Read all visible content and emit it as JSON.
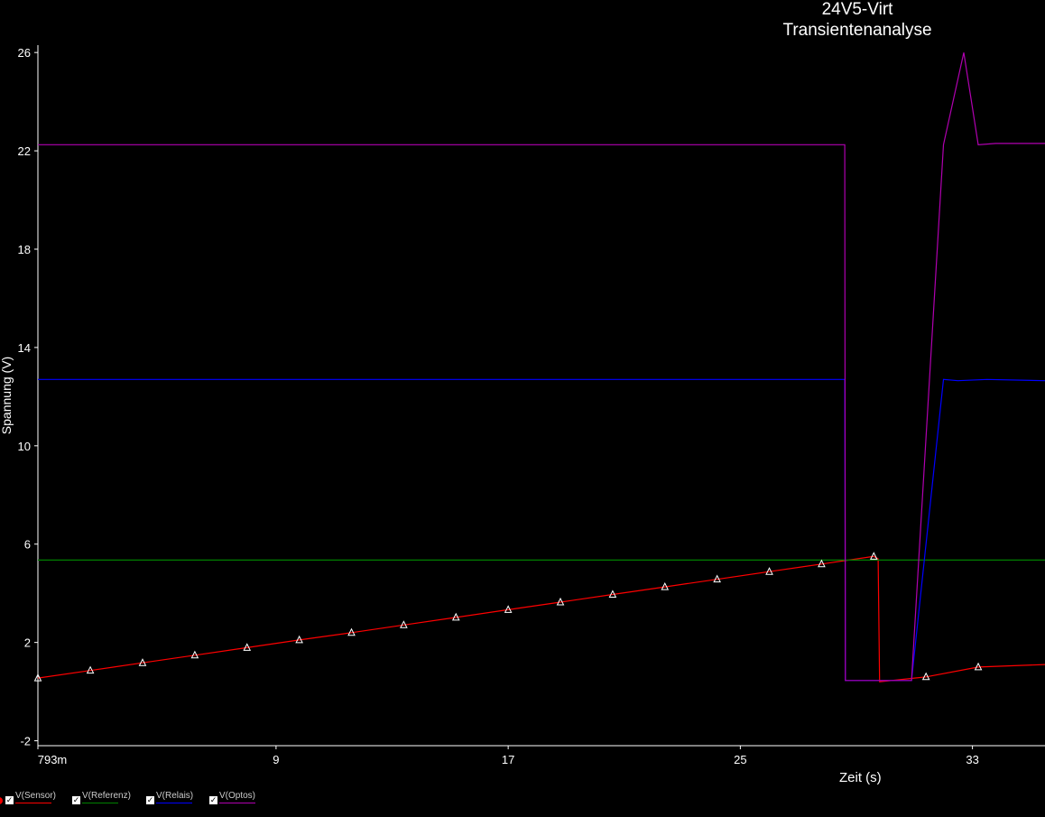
{
  "chart_data": {
    "type": "line",
    "title": "24V5-Virt",
    "subtitle": "Transientenanalyse",
    "xlabel": "Zeit (s)",
    "ylabel": "Spannung (V)",
    "xlim": [
      0.793,
      35.5
    ],
    "ylim": [
      -2.2,
      26.3
    ],
    "x_ticks": [
      {
        "v": 0.793,
        "label": "793m"
      },
      {
        "v": 9,
        "label": "9"
      },
      {
        "v": 17,
        "label": "17"
      },
      {
        "v": 25,
        "label": "25"
      },
      {
        "v": 33,
        "label": "33"
      }
    ],
    "y_ticks": [
      26,
      22,
      18,
      14,
      10,
      6,
      2,
      -2
    ],
    "series": [
      {
        "name": "V(Sensor)",
        "color": "#ff0000",
        "marker_color": "#ffffff",
        "x": [
          0.793,
          2.6,
          4.4,
          6.2,
          8.0,
          9.8,
          11.6,
          13.4,
          15.2,
          17.0,
          18.8,
          20.6,
          22.4,
          24.2,
          26.0,
          27.8,
          29.6,
          29.75,
          29.8,
          31.4,
          33.2,
          35.5
        ],
        "y": [
          0.55,
          0.86,
          1.17,
          1.48,
          1.79,
          2.1,
          2.4,
          2.71,
          3.02,
          3.33,
          3.64,
          3.95,
          4.26,
          4.57,
          4.88,
          5.19,
          5.5,
          5.4,
          0.4,
          0.6,
          1.0,
          1.1
        ],
        "markers_x": [
          0.793,
          2.6,
          4.4,
          6.2,
          8.0,
          9.8,
          11.6,
          13.4,
          15.2,
          17.0,
          18.8,
          20.6,
          22.4,
          24.2,
          26.0,
          27.8,
          29.6,
          31.4,
          33.2
        ],
        "markers_y": [
          0.55,
          0.86,
          1.17,
          1.48,
          1.79,
          2.1,
          2.4,
          2.71,
          3.02,
          3.33,
          3.64,
          3.95,
          4.26,
          4.57,
          4.88,
          5.19,
          5.5,
          0.6,
          1.0
        ]
      },
      {
        "name": "V(Referenz)",
        "color": "#008000",
        "x": [
          0.793,
          35.5
        ],
        "y": [
          5.35,
          5.35
        ]
      },
      {
        "name": "V(Relais)",
        "color": "#0000ff",
        "x": [
          0.793,
          28.6,
          28.62,
          30.9,
          32.0,
          32.5,
          33.5,
          35.5
        ],
        "y": [
          12.7,
          12.7,
          0.45,
          0.45,
          12.7,
          12.65,
          12.7,
          12.65
        ]
      },
      {
        "name": "V(Optos)",
        "color": "#b000b0",
        "x": [
          0.793,
          28.6,
          28.62,
          30.9,
          32.0,
          32.7,
          33.2,
          33.8,
          34.5,
          35.5
        ],
        "y": [
          22.25,
          22.25,
          0.45,
          0.45,
          22.25,
          26.0,
          22.25,
          22.3,
          22.3,
          22.3
        ]
      }
    ],
    "legend_placement": "bottom-left"
  }
}
